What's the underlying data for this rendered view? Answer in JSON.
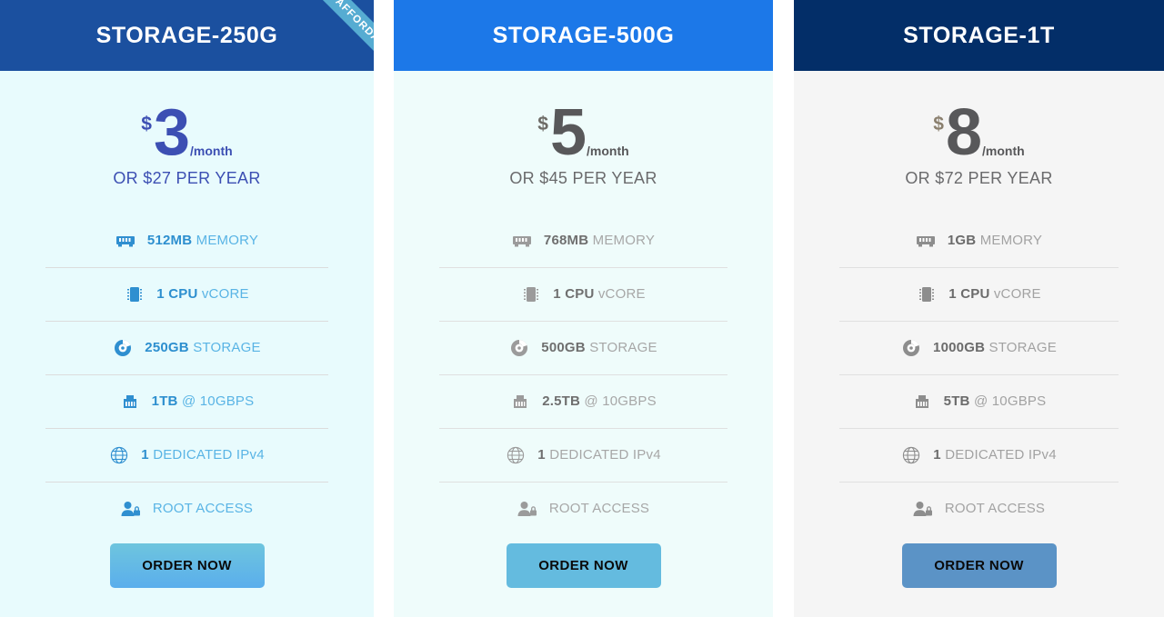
{
  "plans": [
    {
      "title": "STORAGE-250G",
      "ribbon": "AFFORDABLE",
      "currency": "$",
      "amount": "3",
      "per": "/month",
      "per_year": "OR $27 PER YEAR",
      "header_color": "#1b509f",
      "body_color": "#e8fbfd",
      "accent_color": "#3c4fb3",
      "features": [
        {
          "icon": "ram-icon",
          "value": "512MB",
          "label": "MEMORY"
        },
        {
          "icon": "cpu-icon",
          "value": "1 CPU",
          "label": "vCORE"
        },
        {
          "icon": "disk-icon",
          "value": "250GB",
          "label": "STORAGE"
        },
        {
          "icon": "network-icon",
          "value": "1TB",
          "label": "@ 10GBPS"
        },
        {
          "icon": "globe-icon",
          "value": "1",
          "label": "DEDICATED IPv4"
        },
        {
          "icon": "user-lock-icon",
          "value": "",
          "label": "ROOT ACCESS"
        }
      ],
      "order_label": "ORDER NOW"
    },
    {
      "title": "STORAGE-500G",
      "ribbon": "",
      "currency": "$",
      "amount": "5",
      "per": "/month",
      "per_year": "OR $45 PER YEAR",
      "header_color": "#1c78e8",
      "body_color": "#effcfb",
      "accent_color": "#58585a",
      "features": [
        {
          "icon": "ram-icon",
          "value": "768MB",
          "label": "MEMORY"
        },
        {
          "icon": "cpu-icon",
          "value": "1 CPU",
          "label": "vCORE"
        },
        {
          "icon": "disk-icon",
          "value": "500GB",
          "label": "STORAGE"
        },
        {
          "icon": "network-icon",
          "value": "2.5TB",
          "label": "@ 10GBPS"
        },
        {
          "icon": "globe-icon",
          "value": "1",
          "label": "DEDICATED IPv4"
        },
        {
          "icon": "user-lock-icon",
          "value": "",
          "label": "ROOT ACCESS"
        }
      ],
      "order_label": "ORDER NOW"
    },
    {
      "title": "STORAGE-1T",
      "ribbon": "",
      "currency": "$",
      "amount": "8",
      "per": "/month",
      "per_year": "OR $72 PER YEAR",
      "header_color": "#032e68",
      "body_color": "#f5f5f5",
      "accent_color": "#58585a",
      "features": [
        {
          "icon": "ram-icon",
          "value": "1GB",
          "label": "MEMORY"
        },
        {
          "icon": "cpu-icon",
          "value": "1 CPU",
          "label": "vCORE"
        },
        {
          "icon": "disk-icon",
          "value": "1000GB",
          "label": "STORAGE"
        },
        {
          "icon": "network-icon",
          "value": "5TB",
          "label": "@ 10GBPS"
        },
        {
          "icon": "globe-icon",
          "value": "1",
          "label": "DEDICATED IPv4"
        },
        {
          "icon": "user-lock-icon",
          "value": "",
          "label": "ROOT ACCESS"
        }
      ],
      "order_label": "ORDER NOW"
    }
  ]
}
